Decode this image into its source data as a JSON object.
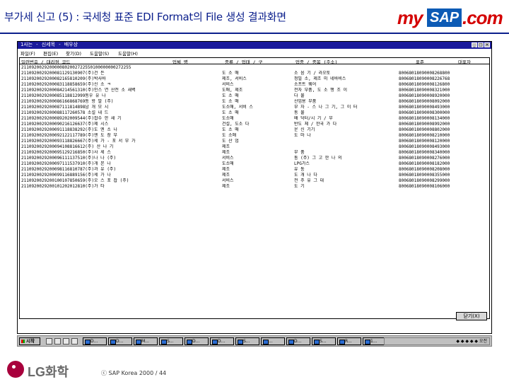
{
  "slide": {
    "title": "부가세 신고 (5) : 국세청 표준 EDI Format의 File 생성 결과화면",
    "logo_my": "my",
    "logo_sap": "SAP",
    "logo_com": ".com",
    "footer_logo": "LG화학",
    "copyright": "ⓒ  SAP Korea 2000  /  44"
  },
  "window": {
    "title": "1사는 - 신세목 - 배우상",
    "menu": [
      "파일(F)",
      "편집(E)",
      "찾기(D)",
      "도움말(S)",
      "도움말(H)"
    ],
    "columns": [
      "일련번호 / 대리점 코드",
      "업체 명",
      "종류 / 업태 / 구",
      "업종 / 종목 (주소)",
      "표준",
      "대표자"
    ],
    "close_label": "닫기(X)"
  },
  "rows": [
    {
      "key": "2110920029200000802002722550100000000272255",
      "type": "",
      "item": "",
      "code": ""
    },
    {
      "key": "2110920029200081129130907(주)건 든",
      "type": "도 소 매",
      "item": "소 음 기 / 라오토",
      "code": "80068018090008268800"
    },
    {
      "key": "2110920029200082165810209(주)박사바",
      "type": "제조, 서비스",
      "item": "정밀 소, 제조 미 네바비스",
      "code": "80068018090008226768"
    },
    {
      "key": "2110920029200083118858659(주)신 소 ㅋ",
      "type": "서비스",
      "item": "소프트 웨어",
      "code": "80068018090008126800"
    },
    {
      "key": "2110920029200084214561310(주)인스 연 산전 소 새벽",
      "type": "도매, 제조",
      "item": "전자 부품, 도 소 행 조 이",
      "code": "80068018090008321000"
    },
    {
      "key": "2110920029200085118812999동우 유 나",
      "type": "도 소 매",
      "item": "다 물",
      "code": "80068018090008920000"
    },
    {
      "key": "2110920029200086166868769동 방 발 (주)",
      "type": "도 소 매",
      "item": "산업용 부품",
      "code": "80068018090008092000"
    },
    {
      "key": "2110920029200087111814898남 개 모 시",
      "type": "도소매, 서비 스",
      "item": "부 자 - 스 나 그 기, 그 이 터",
      "code": "80068018090008493000"
    },
    {
      "key": "2110920029200088117260578 소설 내 드",
      "type": "도 소 매",
      "item": "동 물",
      "code": "80068018090008300000"
    },
    {
      "key": "2110920029200089202009544(주)잡수 한 새 기",
      "type": "도소매",
      "item": "배 닥터/시 기 / 부",
      "code": "80068018090008134000"
    },
    {
      "key": "2110920029200090216126637(주)제 시스",
      "type": "건설, 도소 다",
      "item": "반도 체 / 한국 가 다",
      "code": "80068018090008992000"
    },
    {
      "key": "2110920029200091118838292(주)도 엔 소 나",
      "type": "도 소 매",
      "item": "운 신 기기",
      "code": "80068018090008802000"
    },
    {
      "key": "2110920029200092122117789(주)엔 도 장 부",
      "type": "도 소매",
      "item": "도 마 나",
      "code": "80068018090008210000"
    },
    {
      "key": "2110920029200093118826667(주)세 가 - 포 서 부 가",
      "type": "도 산 업",
      "item": "",
      "code": "80068018090008120000"
    },
    {
      "key": "2110920029200094108816612(주) 산 나 기",
      "type": "제조",
      "item": "",
      "code": "80068018090008493000"
    },
    {
      "key": "2110920029200095129216850(주)사 세 스",
      "type": "제조",
      "item": "부 품",
      "code": "80068018090008340000"
    },
    {
      "key": "2110920029200096111137510(주)나 나 (주)",
      "type": "서비스",
      "item": "통 (주) 그 고 한 나 의",
      "code": "80068018090008276000"
    },
    {
      "key": "2110920029200097111537910(주)개 본 나",
      "type": "도소매",
      "item": "LPG가스",
      "code": "80068018090008182000"
    },
    {
      "key": "2110920029200098116810787(주)과 유 (주)",
      "type": "제조",
      "item": "유 통",
      "code": "80068018090008208000"
    },
    {
      "key": "2110920029200099116889156(주)세 가 나",
      "type": "제조",
      "item": "도 개 나 다",
      "code": "80068018090008355000"
    },
    {
      "key": "2110920029200100107850659(주)오 스 포 잡 (주)",
      "type": "서비스",
      "item": "전 주 유 그 대",
      "code": "80068018090008299000"
    },
    {
      "key": "2110920029200101202012810(주)가 타",
      "type": "제조",
      "item": "도 기",
      "code": "80068018090008106000"
    }
  ],
  "taskbar": {
    "start_label": "시작",
    "quick_icons": [
      "desktop-icon",
      "explorer-icon",
      "mail-icon",
      "more-icon"
    ],
    "tasks": [
      "D...",
      "D...",
      "M...",
      "S...",
      "D...",
      "D...",
      "S...",
      "...",
      "D...",
      "S...",
      "R...",
      "1..."
    ],
    "tray_text": "◆ ◆ ◆ ◆ ◆ 오전"
  }
}
